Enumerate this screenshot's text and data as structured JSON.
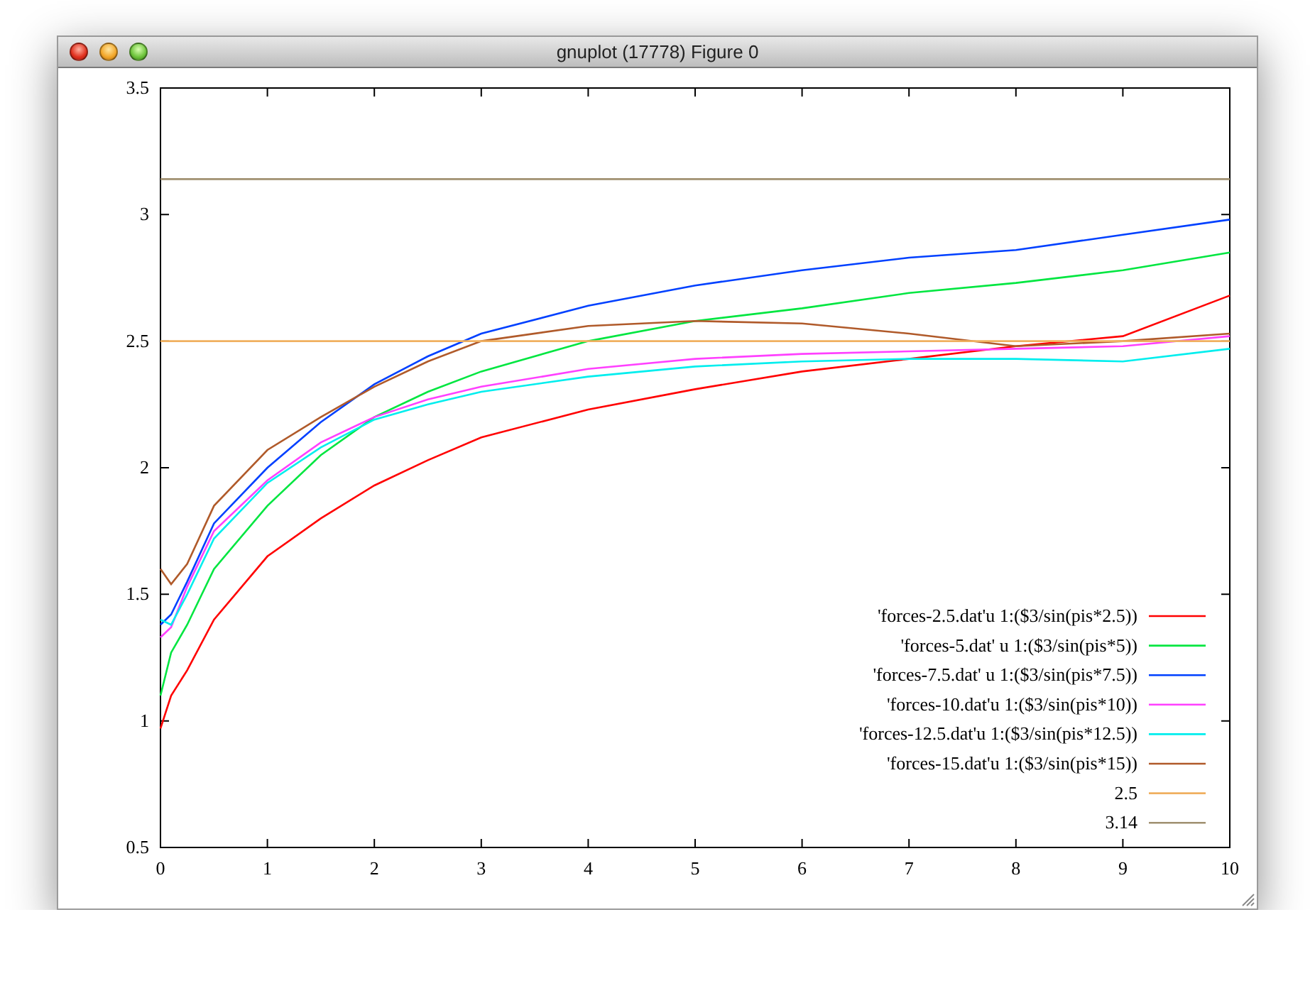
{
  "window": {
    "title": "gnuplot (17778) Figure 0"
  },
  "plot": {
    "chart_data": {
      "type": "line",
      "legend": true,
      "xlim": [
        0,
        10
      ],
      "ylim": [
        0.5,
        3.5
      ],
      "xticks": [
        0,
        1,
        2,
        3,
        4,
        5,
        6,
        7,
        8,
        9,
        10
      ],
      "yticks": [
        {
          "value": 0.5,
          "label": "0.5"
        },
        {
          "value": 1,
          "label": "1"
        },
        {
          "value": 1.5,
          "label": "1.5"
        },
        {
          "value": 2,
          "label": "2"
        },
        {
          "value": 2.5,
          "label": "2.5"
        },
        {
          "value": 3,
          "label": "3"
        },
        {
          "value": 3.5,
          "label": "3.5"
        }
      ],
      "x": [
        0,
        0.1,
        0.25,
        0.5,
        1,
        1.5,
        2,
        2.5,
        3,
        4,
        5,
        6,
        7,
        8,
        9,
        10
      ],
      "series": [
        {
          "name": "'forces-2.5.dat'u 1:($3/sin(pis*2.5))",
          "color": "#ff0000",
          "values": [
            0.97,
            1.1,
            1.2,
            1.4,
            1.65,
            1.8,
            1.93,
            2.03,
            2.12,
            2.23,
            2.31,
            2.38,
            2.43,
            2.48,
            2.52,
            2.68
          ]
        },
        {
          "name": "'forces-5.dat' u 1:($3/sin(pis*5))",
          "color": "#00e640",
          "values": [
            1.1,
            1.27,
            1.38,
            1.6,
            1.85,
            2.05,
            2.2,
            2.3,
            2.38,
            2.5,
            2.58,
            2.63,
            2.69,
            2.73,
            2.78,
            2.85
          ]
        },
        {
          "name": "'forces-7.5.dat' u 1:($3/sin(pis*7.5))",
          "color": "#0040ff",
          "values": [
            1.38,
            1.42,
            1.55,
            1.78,
            2.0,
            2.18,
            2.33,
            2.44,
            2.53,
            2.64,
            2.72,
            2.78,
            2.83,
            2.86,
            2.92,
            2.98
          ]
        },
        {
          "name": "'forces-10.dat'u 1:($3/sin(pis*10))",
          "color": "#ff40ff",
          "values": [
            1.33,
            1.37,
            1.53,
            1.75,
            1.95,
            2.1,
            2.2,
            2.27,
            2.32,
            2.39,
            2.43,
            2.45,
            2.46,
            2.47,
            2.48,
            2.52
          ]
        },
        {
          "name": "'forces-12.5.dat'u 1:($3/sin(pis*12.5))",
          "color": "#00eeee",
          "values": [
            1.4,
            1.38,
            1.5,
            1.72,
            1.94,
            2.08,
            2.19,
            2.25,
            2.3,
            2.36,
            2.4,
            2.42,
            2.43,
            2.43,
            2.42,
            2.47
          ]
        },
        {
          "name": "'forces-15.dat'u 1:($3/sin(pis*15))",
          "color": "#b05a2a",
          "values": [
            1.6,
            1.54,
            1.62,
            1.85,
            2.07,
            2.2,
            2.32,
            2.42,
            2.5,
            2.56,
            2.58,
            2.57,
            2.53,
            2.48,
            2.5,
            2.53
          ]
        },
        {
          "name": "2.5",
          "color": "#f0b060",
          "values": [
            2.5,
            2.5,
            2.5,
            2.5,
            2.5,
            2.5,
            2.5,
            2.5,
            2.5,
            2.5,
            2.5,
            2.5,
            2.5,
            2.5,
            2.5,
            2.5
          ]
        },
        {
          "name": "3.14",
          "color": "#a09070",
          "values": [
            3.14,
            3.14,
            3.14,
            3.14,
            3.14,
            3.14,
            3.14,
            3.14,
            3.14,
            3.14,
            3.14,
            3.14,
            3.14,
            3.14,
            3.14,
            3.14
          ]
        }
      ]
    }
  }
}
